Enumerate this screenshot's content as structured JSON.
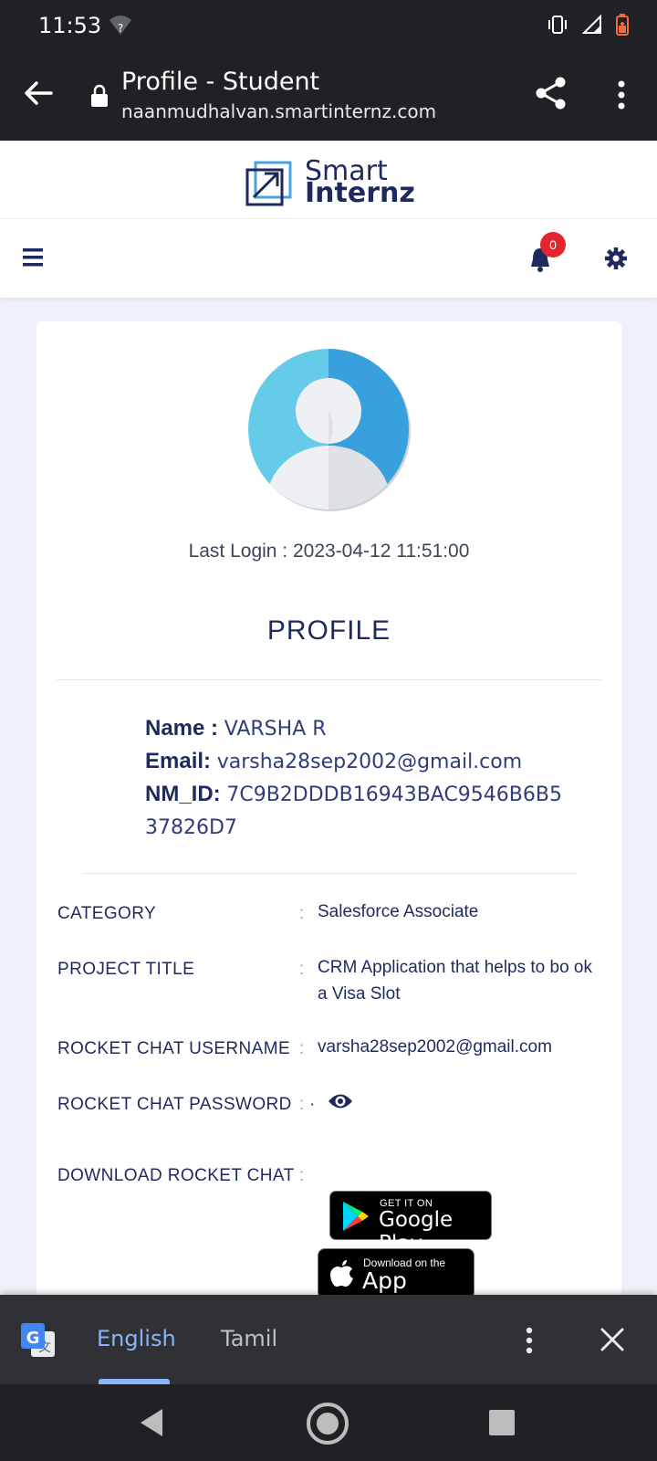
{
  "status_bar": {
    "time": "11:53"
  },
  "browser": {
    "title": "Profile - Student",
    "url": "naanmudhalvan.smartinternz.com"
  },
  "site": {
    "logo_line1": "Smart",
    "logo_line2": "Internz",
    "notification_count": "0"
  },
  "profile": {
    "last_login": "Last Login : 2023-04-12 11:51:00",
    "heading": "PROFILE",
    "name_label": "Name : ",
    "name_value": "VARSHA R",
    "email_label": "Email: ",
    "email_value": "varsha28sep2002@gmail.com",
    "nmid_label": "NM_ID: ",
    "nmid_value": "7C9B2DDDB16943BAC9546B6B5 37826D7"
  },
  "details": [
    {
      "label": "CATEGORY",
      "value": "Salesforce Associate"
    },
    {
      "label": "PROJECT TITLE",
      "value": "CRM Application that helps to bo ok a Visa Slot"
    },
    {
      "label": "ROCKET CHAT USERNAME",
      "value": "varsha28sep2002@gmail.com"
    },
    {
      "label": "ROCKET CHAT PASSWORD",
      "value": "·"
    },
    {
      "label": "DOWNLOAD ROCKET CHAT",
      "value": ""
    }
  ],
  "colon": ":",
  "stores": {
    "gplay_small": "GET IT ON",
    "gplay_big": "Google Play",
    "appstore_small": "Download on the",
    "appstore_big": "App Store"
  },
  "translate": {
    "lang1": "English",
    "lang2": "Tamil"
  }
}
